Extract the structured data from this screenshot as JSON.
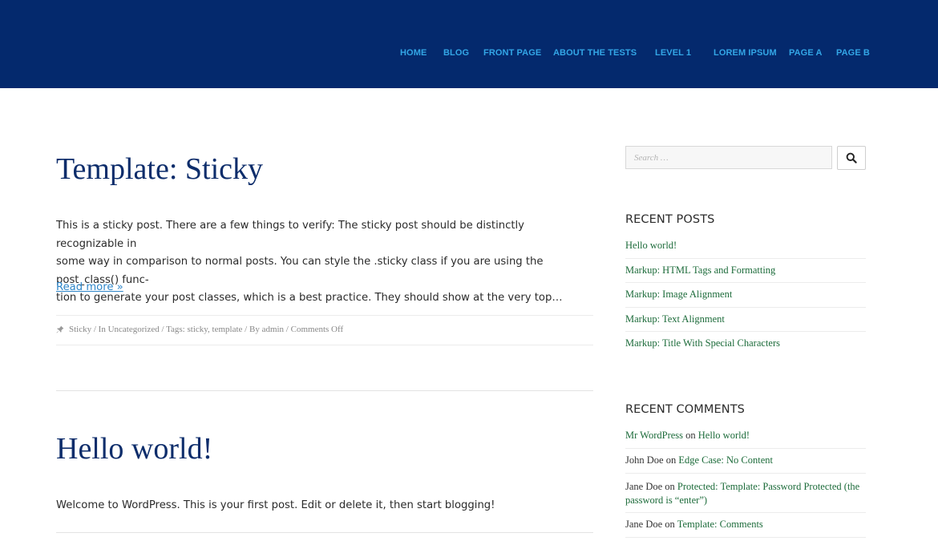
{
  "nav": {
    "items": [
      "HOME",
      "BLOG",
      "FRONT PAGE",
      "ABOUT THE TESTS",
      "LEVEL 1",
      "LOREM IPSUM",
      "PAGE A",
      "PAGE B"
    ]
  },
  "posts": [
    {
      "title": "Template: Sticky",
      "excerpt_lines": [
        "This is a sticky post. There are a few things to verify: The sticky post should be distinctly recognizable in",
        "some way in comparison to normal posts. You can style the .sticky class if you are using the post_class() func-",
        "tion to generate your post classes, which is a best practice. They should show at the very top…"
      ],
      "read_more": "Read more »",
      "meta": "Sticky / In Uncategorized / Tags: sticky, template / By admin / Comments Off"
    },
    {
      "title": "Hello world!",
      "excerpt": "Welcome to WordPress. This is your first post. Edit or delete it, then start blogging!"
    }
  ],
  "sidebar": {
    "search": {
      "placeholder": "Search …"
    },
    "recent_posts": {
      "title": "RECENT POSTS",
      "items": [
        "Hello world!",
        "Markup: HTML Tags and Formatting",
        "Markup: Image Alignment",
        "Markup: Text Alignment",
        "Markup: Title With Special Characters"
      ]
    },
    "recent_comments": {
      "title": "RECENT COMMENTS",
      "on": "on",
      "items": [
        {
          "author": "Mr WordPress",
          "post": "Hello world!"
        },
        {
          "author": "John Doe",
          "post": "Edge Case: No Content"
        },
        {
          "author": "Jane Doe",
          "post": "Protected: Template: Password Protected (the password is “enter”)"
        },
        {
          "author": "Jane Doe",
          "post": "Template: Comments"
        }
      ]
    }
  },
  "colors": {
    "header_bg": "#04296d",
    "nav_link": "#33a6e6",
    "post_title": "#0d2d6b",
    "read_more": "#2e86c9",
    "widget_link": "#1c6b3a"
  }
}
